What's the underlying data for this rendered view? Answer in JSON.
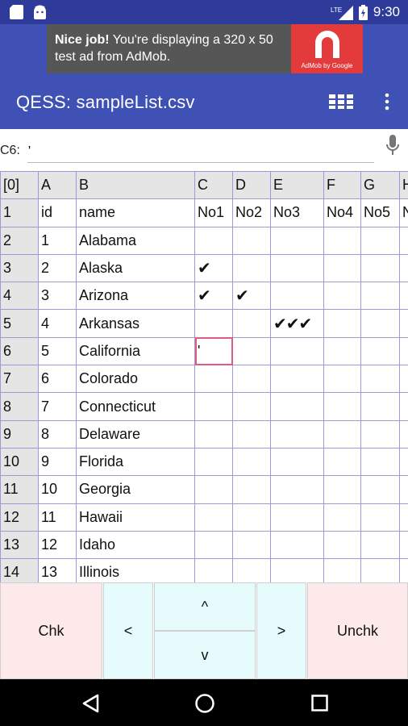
{
  "status_bar": {
    "time": "9:30",
    "network": "LTE",
    "icons": [
      "sd-card-icon",
      "android-icon",
      "signal-icon",
      "battery-icon"
    ]
  },
  "ad": {
    "headline": "Nice job!",
    "body": " You're displaying a 320 x 50 test ad from AdMob.",
    "brand": "AdMob by Google"
  },
  "app_bar": {
    "title": "QESS: sampleList.csv",
    "icons": [
      "grid-view-icon",
      "overflow-menu-icon"
    ]
  },
  "formula_bar": {
    "cell_ref": "C6:",
    "value": "'"
  },
  "sheet": {
    "column_headers": [
      "[0]",
      "A",
      "B",
      "C",
      "D",
      "E",
      "F",
      "G",
      "H"
    ],
    "rows": [
      [
        "1",
        "id",
        "name",
        "No1",
        "No2",
        "No3",
        "No4",
        "No5",
        "N"
      ],
      [
        "2",
        "1",
        "Alabama",
        "",
        "",
        "",
        "",
        "",
        ""
      ],
      [
        "3",
        "2",
        "Alaska",
        "✔",
        "",
        "",
        "",
        "",
        ""
      ],
      [
        "4",
        "3",
        "Arizona",
        "✔",
        "✔",
        "",
        "",
        "",
        ""
      ],
      [
        "5",
        "4",
        "Arkansas",
        "",
        "",
        "✔✔✔",
        "",
        "",
        ""
      ],
      [
        "6",
        "5",
        "California",
        "'",
        "",
        "",
        "",
        "",
        ""
      ],
      [
        "7",
        "6",
        "Colorado",
        "",
        "",
        "",
        "",
        "",
        ""
      ],
      [
        "8",
        "7",
        "Connecticut",
        "",
        "",
        "",
        "",
        "",
        ""
      ],
      [
        "9",
        "8",
        "Delaware",
        "",
        "",
        "",
        "",
        "",
        ""
      ],
      [
        "10",
        "9",
        "Florida",
        "",
        "",
        "",
        "",
        "",
        ""
      ],
      [
        "11",
        "10",
        "Georgia",
        "",
        "",
        "",
        "",
        "",
        ""
      ],
      [
        "12",
        "11",
        "Hawaii",
        "",
        "",
        "",
        "",
        "",
        ""
      ],
      [
        "13",
        "12",
        "Idaho",
        "",
        "",
        "",
        "",
        "",
        ""
      ],
      [
        "14",
        "13",
        "Illinois",
        "",
        "",
        "",
        "",
        "",
        ""
      ]
    ],
    "selected_cell": "C6"
  },
  "buttons": {
    "chk": "Chk",
    "left": "<",
    "up": "^",
    "down": "v",
    "right": ">",
    "unchk": "Unchk"
  },
  "colors": {
    "status_bar": "#2f3b9a",
    "app_bar": "#3f51b5",
    "grid_line": "#9b9bd6",
    "header_bg": "#e5e5e5",
    "selection": "#e05a82",
    "pink_button": "#fde9e9",
    "cyan_button": "#e6fcfc"
  }
}
